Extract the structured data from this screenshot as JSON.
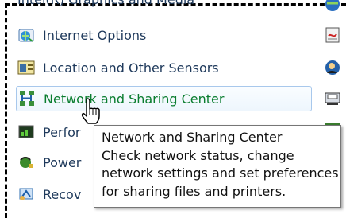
{
  "partial_top_item": "Intel(R) Graphics and Media",
  "items": [
    {
      "label": "Internet Options",
      "icon": "internet-options-icon"
    },
    {
      "label": "Location and Other Sensors",
      "icon": "location-sensors-icon"
    },
    {
      "label": "Network and Sharing Center",
      "icon": "network-icon"
    },
    {
      "label": "Perfor",
      "icon": "performance-icon"
    },
    {
      "label": "Power",
      "icon": "power-icon"
    },
    {
      "label": "Recov",
      "icon": "recovery-icon"
    }
  ],
  "tooltip": {
    "title": "Network and Sharing Center",
    "line1": "Check network status, change",
    "line2": "network settings and set preferences",
    "line3": "for sharing files and printers."
  },
  "colors": {
    "link": "#1e395b",
    "hover_link": "#0a7d2f",
    "hover_border": "#a8c8ec"
  }
}
